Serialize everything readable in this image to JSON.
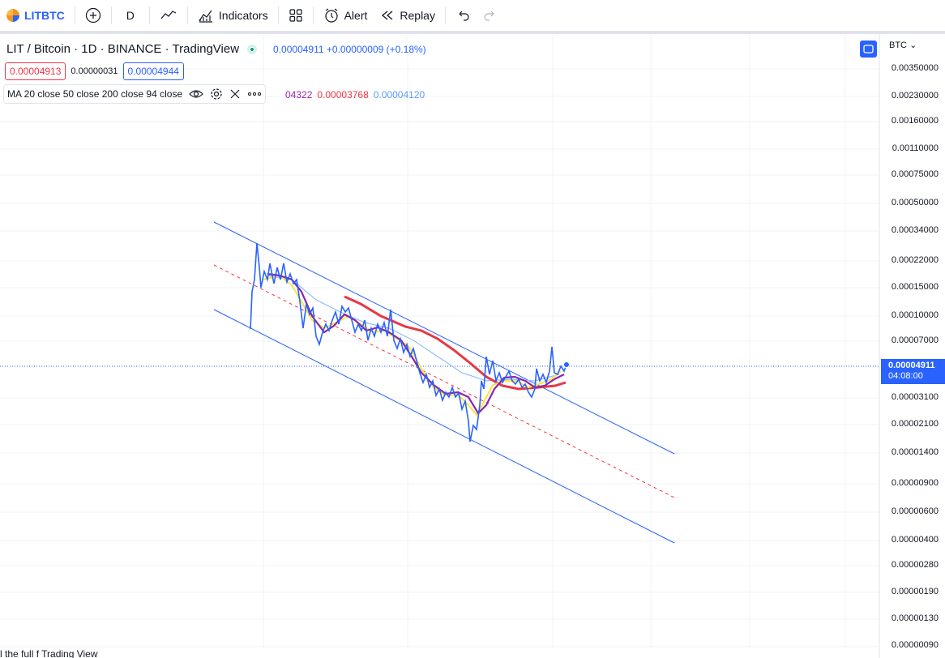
{
  "toolbar": {
    "symbol": "LITBTC",
    "interval": "D",
    "indicators_label": "Indicators",
    "alert_label": "Alert",
    "replay_label": "Replay"
  },
  "legend": {
    "title": "LIT / Bitcoin · 1D · BINANCE · TradingView",
    "last_price": "0.00004911",
    "change": "+0.00000009 (+0.18%)",
    "sell_price": "0.00004913",
    "spread": "0.00000031",
    "buy_price": "0.00004944",
    "ma_label": "MA 20 close 50 close 200 close 94 close",
    "ma_values": [
      {
        "value": "04322",
        "color": "#9c27b0"
      },
      {
        "value": "0.00003768",
        "color": "#f23645"
      },
      {
        "value": "0.00004120",
        "color": "#5b9cf6"
      }
    ]
  },
  "price_axis": {
    "currency": "BTC",
    "labels": [
      "0.00350000",
      "0.00230000",
      "0.00160000",
      "0.00110000",
      "0.00075000",
      "0.00050000",
      "0.00034000",
      "0.00022000",
      "0.00015000",
      "0.00010000",
      "0.00007000",
      "0.00003100",
      "0.00002100",
      "0.00001400",
      "0.00000900",
      "0.00000600",
      "0.00000400",
      "0.00000280",
      "0.00000190",
      "0.00000130",
      "0.00000090"
    ],
    "current_price": "0.00004911",
    "countdown": "04:08:00"
  },
  "footer": {
    "text": "l the full                  f Trading View"
  },
  "colors": {
    "accent": "#2962ff",
    "price_line": "#2962ff",
    "ma20": "#9c27b0",
    "ma50": "#ffeb3b",
    "ma200": "#f23645",
    "ma94": "#90bff9"
  }
}
